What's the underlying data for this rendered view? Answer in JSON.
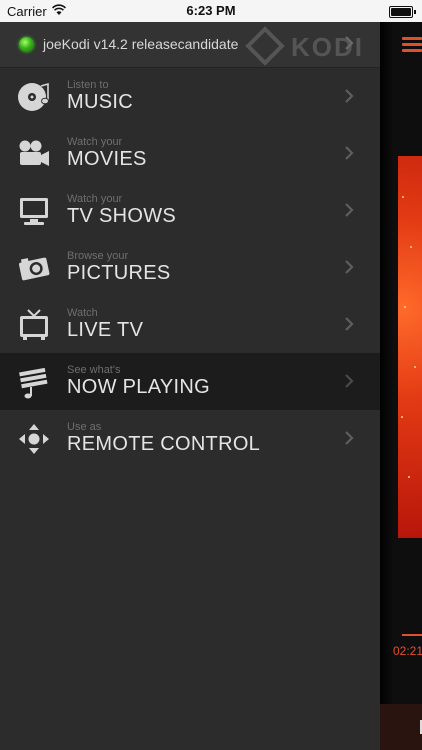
{
  "status_bar": {
    "carrier": "Carrier",
    "time": "6:23 PM"
  },
  "server": {
    "name": "joeKodi v14.2 releasecandidate",
    "logo_text": "KODI"
  },
  "menu": [
    {
      "sub": "Listen to",
      "label": "MUSIC",
      "icon": "music-icon"
    },
    {
      "sub": "Watch your",
      "label": "MOVIES",
      "icon": "movie-camera-icon"
    },
    {
      "sub": "Watch your",
      "label": "TV SHOWS",
      "icon": "monitor-icon"
    },
    {
      "sub": "Browse your",
      "label": "PICTURES",
      "icon": "camera-icon"
    },
    {
      "sub": "Watch",
      "label": "LIVE TV",
      "icon": "tv-icon"
    },
    {
      "sub": "See what's",
      "label": "NOW PLAYING",
      "icon": "now-playing-icon",
      "active": true
    },
    {
      "sub": "Use as",
      "label": "REMOTE CONTROL",
      "icon": "remote-dpad-icon"
    }
  ],
  "now_playing": {
    "time": "02:21"
  },
  "colors": {
    "accent": "#e2502a",
    "sidebar_bg": "#2c2c2c",
    "active_row": "#1c1c1c"
  }
}
